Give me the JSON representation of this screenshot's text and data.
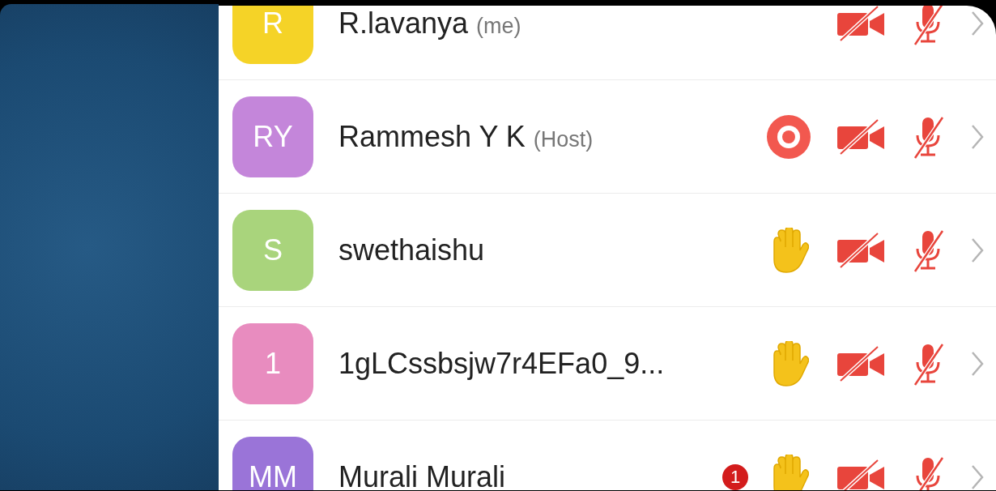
{
  "participants": [
    {
      "initials": "R",
      "name": "R.lavanya",
      "role": "(me)",
      "color": "#f5d327",
      "recording": false,
      "hand_raised": false,
      "video_on": false,
      "mic_on": false
    },
    {
      "initials": "RY",
      "name": "Rammesh Y K",
      "role": "(Host)",
      "color": "#c486da",
      "recording": true,
      "hand_raised": false,
      "video_on": false,
      "mic_on": false
    },
    {
      "initials": "S",
      "name": "swethaishu",
      "color": "#a9d47c",
      "recording": false,
      "hand_raised": true,
      "video_on": false,
      "mic_on": false
    },
    {
      "initials": "1",
      "name": "1gLCssbsjw7r4EFa0_9...",
      "color": "#e88cbf",
      "recording": false,
      "hand_raised": true,
      "video_on": false,
      "mic_on": false
    },
    {
      "initials": "MM",
      "name": "Murali Murali",
      "color": "#9a74d8",
      "badge": "1",
      "recording": false,
      "hand_raised": true,
      "video_on": false,
      "mic_on": false
    }
  ]
}
